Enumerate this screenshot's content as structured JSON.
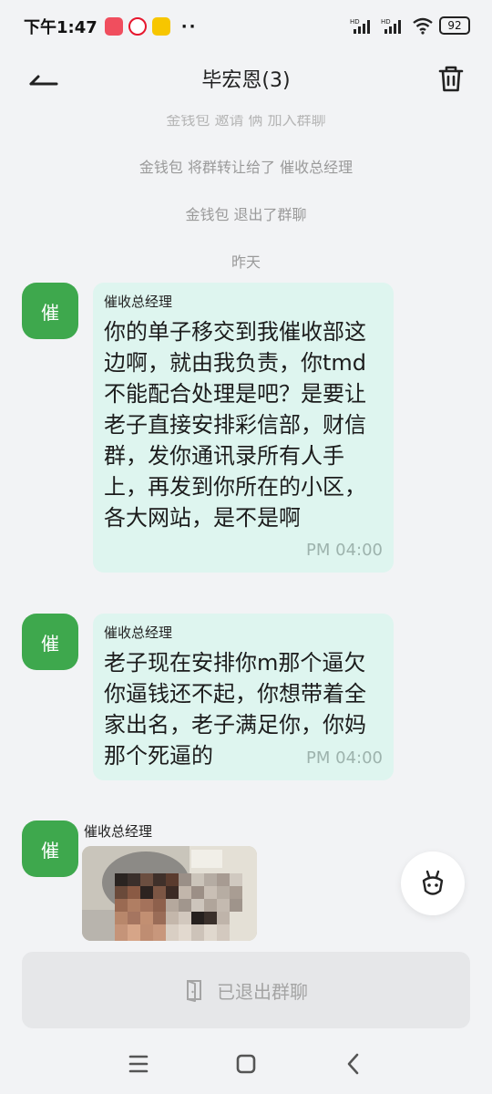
{
  "status_bar": {
    "time": "下午1:47",
    "dots": "··",
    "battery": "92",
    "signal_label": "HD"
  },
  "header": {
    "title": "毕宏恩(3)"
  },
  "system_messages": {
    "cut_top": "金钱包 邀请 俩 加入群聊",
    "transfer": "金钱包 将群转让给了 催收总经理",
    "left": "金钱包 退出了群聊",
    "date": "昨天"
  },
  "messages": [
    {
      "avatar": "催",
      "sender": "催收总经理",
      "text": "你的单子移交到我催收部这边啊，就由我负责，你tmd不能配合处理是吧？是要让老子直接安排彩信部，财信群，发你通讯录所有人手上，再发到你所在的小区，各大网站，是不是啊",
      "time": "PM 04:00"
    },
    {
      "avatar": "催",
      "sender": "催收总经理",
      "text": "老子现在安排你m那个逼欠你逼钱还不起，你想带着全家出名，老子满足你，你妈那个死逼的",
      "time": "PM 04:00"
    },
    {
      "avatar": "催",
      "sender": "催收总经理",
      "type": "image"
    }
  ],
  "bottom": {
    "exit_label": "已退出群聊"
  },
  "colors": {
    "avatar": "#3ea84d",
    "bubble": "#def5ef",
    "background": "#f2f3f5"
  }
}
